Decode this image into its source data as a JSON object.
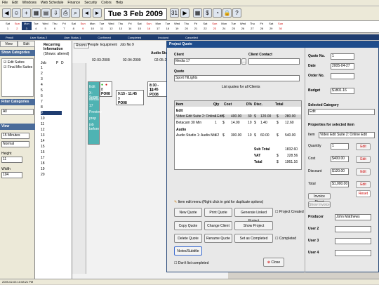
{
  "menu": [
    "File",
    "Edit",
    "Windows",
    "Web Schedule",
    "Finance",
    "Security",
    "Colors",
    "Help"
  ],
  "toolbar": {
    "date": "Tue 3 Feb 2009"
  },
  "calendar": {
    "days": [
      "Sat",
      "Sun",
      "Mon",
      "Tue",
      "Wed",
      "Thu",
      "Fri",
      "Sat",
      "Sun",
      "Mon",
      "Tue",
      "Wed",
      "Thu",
      "Fri",
      "Sat",
      "Sun",
      "Mon",
      "Tue",
      "Wed",
      "Thu",
      "Fri",
      "Sat",
      "Sun",
      "Mon",
      "Tue",
      "Wed",
      "Thu",
      "Fri",
      "Sat",
      "Sun"
    ],
    "dates": [
      "1",
      "2",
      "3",
      "4",
      "5",
      "6",
      "7",
      "8",
      "9",
      "10",
      "11",
      "12",
      "13",
      "14",
      "15",
      "16",
      "17",
      "18",
      "19",
      "20",
      "21",
      "22",
      "23",
      "24",
      "25",
      "26",
      "27",
      "28",
      "29",
      "30"
    ]
  },
  "statusbar": [
    "Pencil",
    "User Status 2",
    "User Status 1",
    "Confirmed",
    "Completed",
    "Invoiced",
    "Cancelled"
  ],
  "left": {
    "tab_view": "View",
    "tab_edit": "Edit",
    "show_categories": "Show Categories",
    "cat1": "Edit Suites",
    "cat2": "Final Mix Suites",
    "filter_categories": "Filter Categories",
    "filter_value": "All",
    "view": "View",
    "interval": "15 Minutes",
    "mode": "Normal",
    "height_label": "Height",
    "height_value": "11",
    "width_label": "Width",
    "width_value": "104"
  },
  "recurring": {
    "title": "Recurring Information",
    "subtitle": "(Shows: altered)",
    "col_job": "Job",
    "col_p": "P",
    "col_d": "D",
    "rows": [
      "1",
      "2",
      "3",
      "4",
      "5",
      "6",
      "7",
      "8",
      "9",
      "10",
      "11",
      "12",
      "13",
      "14",
      "15",
      "16",
      "17",
      "18",
      "19",
      "20"
    ]
  },
  "grid": {
    "tabs": [
      "Rooms",
      "People",
      "Equipment",
      "Job No"
    ],
    "job_value": "9",
    "room_header": "Audio Studio",
    "dates": [
      "02-03-2009",
      "02-04-2009",
      "02-05-2009"
    ],
    "events": [
      {
        "num": "8",
        "tag": "PO08",
        "time": "9:15 - 11:45"
      },
      {
        "num": "9",
        "tag": "PO08",
        "time": ""
      },
      {
        "num": "10",
        "tag": "PO08",
        "time": "8:30 - 11:45"
      }
    ],
    "cyan_lines": [
      "Edit",
      "X-Sugar",
      "Media",
      "17",
      "Preview",
      "prep",
      "job before"
    ]
  },
  "dialog": {
    "title": "Project Quote",
    "client_label": "Client",
    "client_value": "Media 17",
    "contact_label": "Client Contact",
    "quote_label": "Quote",
    "quote_value": "Sport HiLights",
    "list_quotes": "List quotes for all Clients",
    "table_headers": [
      "Item",
      "Qty",
      "Cost",
      "D%",
      "Disc.",
      "Total"
    ],
    "rows": [
      {
        "type": "group",
        "label": "Edit"
      },
      {
        "type": "item",
        "item": "Video Edit Suite 2: Online Edit",
        "qty": "1",
        "cur": "$",
        "cost": "400.00",
        "dp": "30",
        "disc": "$",
        "discv": "120.00",
        "tot": "$",
        "totv": "280.00"
      },
      {
        "type": "item",
        "item": "Betacam 30 Min",
        "qty": "1",
        "cur": "$",
        "cost": "14.00",
        "dp": "10",
        "disc": "$",
        "discv": "1.40",
        "tot": "$",
        "totv": "12.60"
      },
      {
        "type": "group",
        "label": "Audio"
      },
      {
        "type": "item",
        "item": "Audio Studio 1: Audio Mix 2",
        "qty": "3",
        "cur": "$",
        "cost": "300.00",
        "dp": "10",
        "disc": "$",
        "discv": "60.00",
        "tot": "$",
        "totv": "540.00"
      }
    ],
    "sub_total_label": "Sub Total",
    "sub_total": "1832.60",
    "vat_label": "VAT",
    "vat": "228.56",
    "total_label": "Total",
    "total": "1961.16",
    "item_menu_hint": "Item edit menu (Right click in grid for duplicate options)",
    "buttons": {
      "new_quote": "New Quote",
      "print_quote": "Print Quote",
      "linked": "Generate Linked Project",
      "copy_quote": "Copy Quote",
      "change_client": "Change Client",
      "show_project": "Show Project",
      "delete_quote": "Delete Quote",
      "rename_quote": "Rename Quote",
      "set_completed": "Set as Completed",
      "notes": "Notes/Subtitle",
      "close": "Close"
    },
    "project_created": "Project Created",
    "completed": "Completed",
    "dont_list": "Don't list completed"
  },
  "right": {
    "quote_no_label": "Quote No.",
    "quote_no": "1",
    "date_label": "Date",
    "date": "2005-04-27",
    "order_no_label": "Order No.",
    "budget_label": "Budget",
    "budget": "$1801.16",
    "selected_category_label": "Selected Category",
    "selected_category": "Edit",
    "properties_title": "Properties for selected item",
    "item_label": "Item",
    "item_value": "Video Edit Suite 2: Online Edit",
    "quantity_label": "Quantity",
    "quantity": "1",
    "cost_label": "Cost",
    "cost": "$400.00",
    "discount_label": "Discount",
    "discount": "$120.00",
    "total_label": "Total",
    "total": "$1,000.00",
    "edit": "Edit",
    "reset": "Reset",
    "invoice_direct": "Invoice Direct",
    "show_invoice": "Show Invoice",
    "producer_label": "Producer",
    "producer": "John Matthews",
    "user2": "User 2",
    "user3": "User 3",
    "user4": "User 4"
  },
  "bottom_status": "2009-02-03 10:08:21 PM"
}
